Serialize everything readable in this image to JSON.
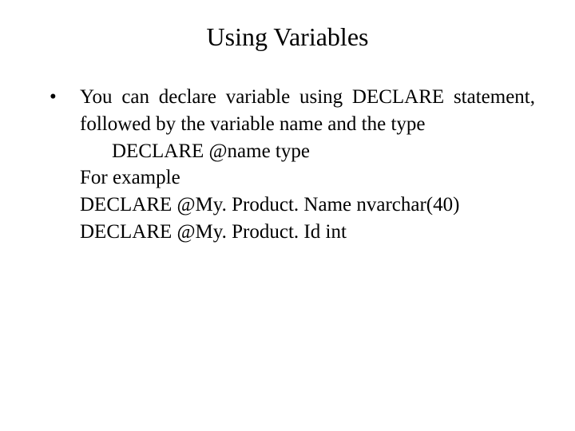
{
  "title": "Using Variables",
  "bullet": {
    "mark": "•",
    "text": "You can declare variable using DECLARE statement, followed by the variable name and the type"
  },
  "syntax_line": "DECLARE @name type",
  "example_label": "For example",
  "example_line1": "DECLARE @My. Product. Name nvarchar(40)",
  "example_line2": "DECLARE @My. Product. Id int"
}
